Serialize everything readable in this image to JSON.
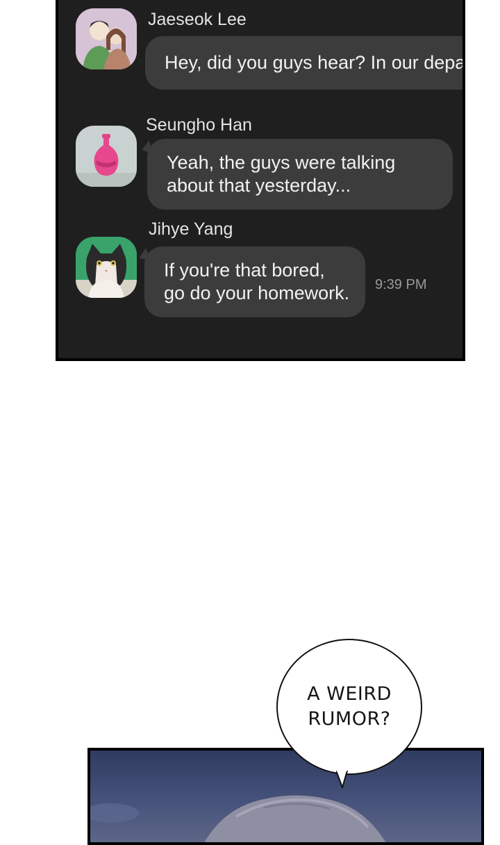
{
  "chat": {
    "messages": [
      {
        "sender": "Jaeseok Lee",
        "lines": [
          "Hey, did you guys hear? In our depart"
        ],
        "avatar": "couple-illustration-avatar"
      },
      {
        "sender": "Seungho Han",
        "lines": [
          "Yeah, the guys were talking",
          "about that yesterday..."
        ],
        "avatar": "pink-vase-avatar"
      },
      {
        "sender": "Jihye Yang",
        "lines": [
          "If you're that bored,",
          "go do your homework."
        ],
        "avatar": "cat-avatar",
        "time": "9:39 PM"
      }
    ]
  },
  "balloon": {
    "lines": [
      "A WEIRD",
      "RUMOR?"
    ]
  },
  "colors": {
    "panel": "#1f1f1f",
    "bubble": "#3c3c3c",
    "scene_sky": "#3a466c"
  }
}
